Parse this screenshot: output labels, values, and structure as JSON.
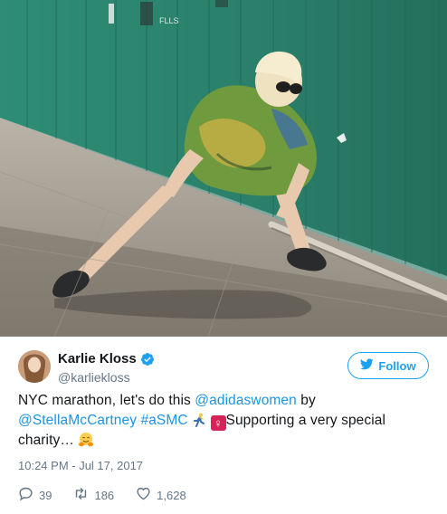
{
  "media": {
    "alt_icon": "photo",
    "wall_text": "FLLS"
  },
  "author": {
    "display_name": "Karlie Kloss",
    "handle": "@karliekloss",
    "verified": true,
    "avatar_icon": "avatar"
  },
  "follow_button": {
    "label": "Follow",
    "icon": "twitter-bird-icon"
  },
  "tweet": {
    "text_part1": "NYC marathon, let's do this ",
    "mention1": "@adidaswomen",
    "text_part2": " by",
    "mention2": "@StellaMcCartney",
    "text_part3": " ",
    "hashtag": "#aSMC",
    "venus_symbol": "♀",
    "text_part4": "Supporting a very special",
    "text_part5": "charity… "
  },
  "timestamp": "10:24 PM - Jul 17, 2017",
  "actions": {
    "reply_count": "39",
    "retweet_count": "186",
    "like_count": "1,628"
  },
  "colors": {
    "link": "#1b95e0",
    "accent": "#1da1f2",
    "muted": "#657786",
    "text": "#14171a",
    "wall_green": "#2e8a72"
  }
}
